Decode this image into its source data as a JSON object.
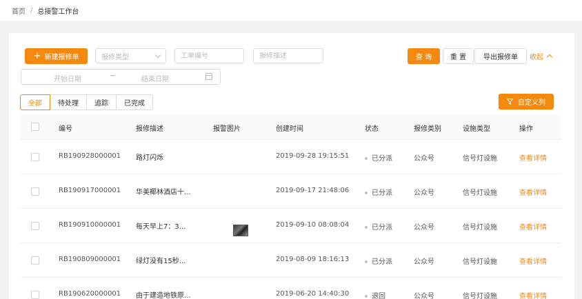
{
  "breadcrumb": {
    "home": "首页",
    "separator": "/",
    "current": "总接警工作台"
  },
  "toolbar": {
    "new_button": "新建报修单",
    "plus_glyph": "+",
    "repair_type_placeholder": "报修类型",
    "order_no_placeholder": "工单编号",
    "description_placeholder": "报修描述",
    "search_button": "查 询",
    "reset_button": "重 置",
    "export_button": "导出报修单",
    "collapse_link": "收起",
    "date_start_placeholder": "开始日期",
    "date_separator": "~",
    "date_end_placeholder": "结束日期",
    "custom_columns_button": "自定义列"
  },
  "tabs": [
    {
      "label": "全部",
      "active": true
    },
    {
      "label": "待处理",
      "active": false
    },
    {
      "label": "追踪",
      "active": false
    },
    {
      "label": "已完成",
      "active": false
    }
  ],
  "table": {
    "headers": {
      "id": "编号",
      "description": "报修描述",
      "image": "报警图片",
      "created": "创建时间",
      "status": "状态",
      "category": "报修类别",
      "facility": "设施类型",
      "action": "操作"
    },
    "rows": [
      {
        "id": "RB190928000001",
        "description": "路灯闪烁",
        "has_image": false,
        "created": "2019-09-28 19:15:51",
        "status": "已分派",
        "category": "公众号",
        "facility": "信号灯设施",
        "action": "查看详情"
      },
      {
        "id": "RB190917000001",
        "description": "华美椰林酒店十...",
        "has_image": false,
        "created": "2019-09-17 21:48:06",
        "status": "已分派",
        "category": "公众号",
        "facility": "信号灯设施",
        "action": "查看详情"
      },
      {
        "id": "RB190910000001",
        "description": "每天早上7：3...",
        "has_image": true,
        "created": "2019-09-10 08:08:04",
        "status": "已分派",
        "category": "公众号",
        "facility": "信号灯设施",
        "action": "查看详情"
      },
      {
        "id": "RB190809000001",
        "description": "绿灯没有15秒...",
        "has_image": false,
        "created": "2019-08-09 18:16:13",
        "status": "已分派",
        "category": "公众号",
        "facility": "信号灯设施",
        "action": "查看详情"
      },
      {
        "id": "RB190620000001",
        "description": "由于建造地铁原...",
        "has_image": false,
        "created": "2019-06-20 14:40:30",
        "status": "退回",
        "category": "公众号",
        "facility": "信号灯设施",
        "action": "查看详情"
      }
    ]
  },
  "colors": {
    "accent": "#f5880f",
    "status_dot": "#c0c0c0"
  },
  "icons": [
    "chevron-down-icon",
    "calendar-icon",
    "chevron-up-icon",
    "filter-icon",
    "plus-icon"
  ]
}
